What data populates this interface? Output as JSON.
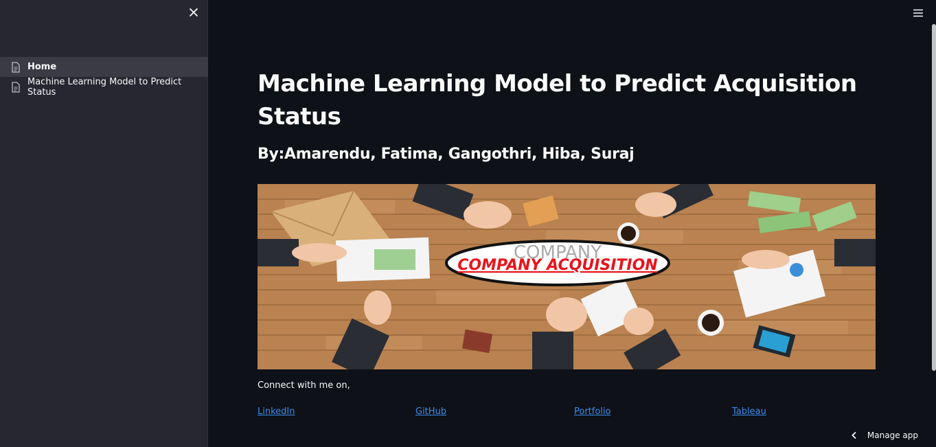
{
  "sidebar": {
    "items": [
      {
        "label": "Home",
        "icon": "document-icon",
        "active": true
      },
      {
        "label": "Machine Learning Model to Predict Status",
        "icon": "document-icon",
        "active": false
      }
    ]
  },
  "main": {
    "title": "Machine Learning Model to Predict Acquisition Status",
    "subtitle": "By:Amarendu, Fatima, Gangothri, Hiba, Suraj",
    "hero_banner_text": "COMPANY ACQUISITION",
    "connect_text": "Connect with me on,",
    "links": [
      "LinkedIn",
      "GitHub",
      "Portfolio",
      "Tableau"
    ]
  },
  "footer": {
    "manage_label": "Manage app"
  },
  "colors": {
    "background": "#0e1117",
    "sidebar": "#262730",
    "link": "#3b8ced",
    "banner_text": "#e8141c"
  }
}
